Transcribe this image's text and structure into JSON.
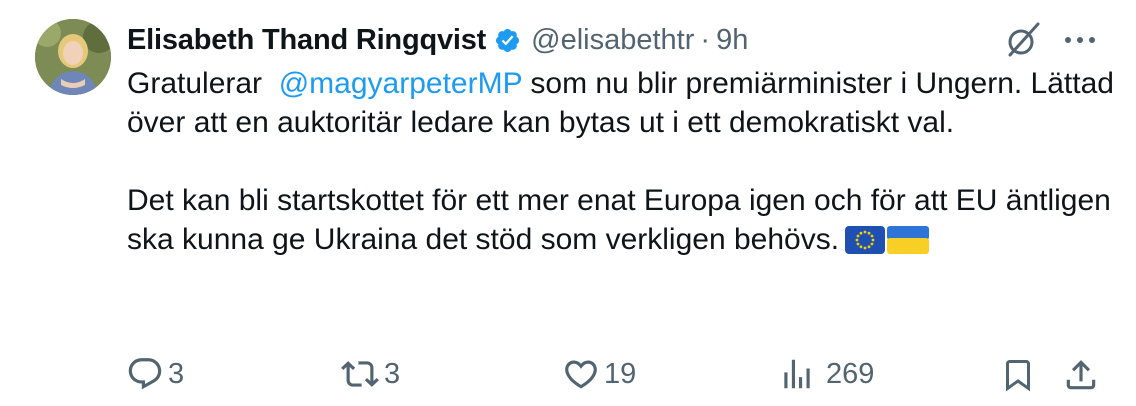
{
  "tweet": {
    "author_name": "Elisabeth Thand Ringqvist",
    "handle": "@elisabethtr",
    "separator": "·",
    "time": "9h",
    "verified": true,
    "body": {
      "line1_prefix": "Gratulerar",
      "mention": "@magyarpeterMP",
      "line1_suffix": "som nu blir premiärminister i Ungern. Lättad över att en auktoritär ledare kan bytas ut i ett demokratiskt val.",
      "para2": "Det kan bli startskottet för ett mer enat Europa igen och för att EU äntligen ska kunna ge Ukraina det stöd som verkligen behövs."
    },
    "emoji": [
      "eu-flag",
      "ukraine-flag"
    ],
    "actions": {
      "replies": "3",
      "reposts": "3",
      "likes": "19",
      "views": "269"
    }
  },
  "icons": {
    "verified": "verified-badge-icon",
    "grok": "grok-icon",
    "more": "more-icon",
    "reply": "reply-icon",
    "repost": "repost-icon",
    "like": "like-icon",
    "views": "views-icon",
    "bookmark": "bookmark-icon",
    "share": "share-icon"
  },
  "colors": {
    "accent": "#1d9bf0",
    "text": "#0f1419",
    "secondary": "#536471"
  }
}
